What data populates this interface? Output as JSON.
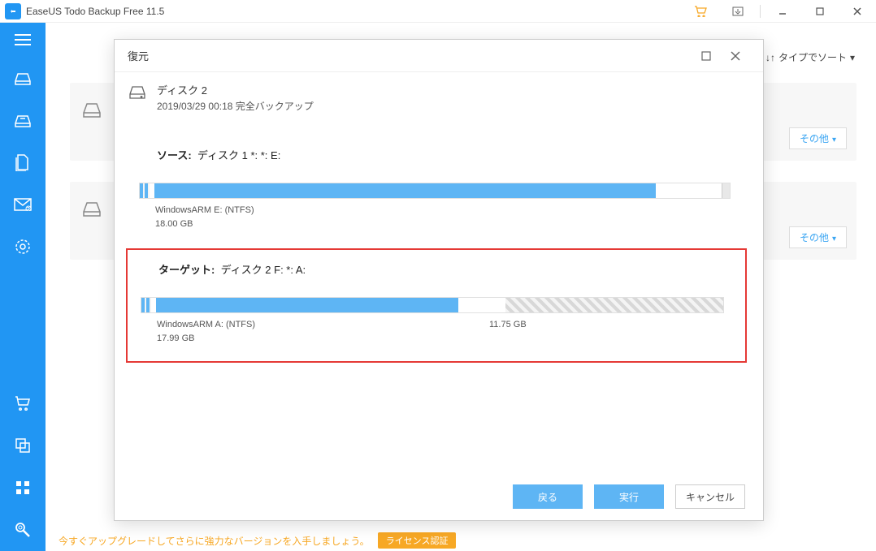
{
  "app": {
    "title": "EaseUS Todo Backup Free 11.5"
  },
  "topright": {
    "sort_label": "タイプでソート"
  },
  "cards": {
    "more_label": "その他"
  },
  "promo": {
    "text": "今すぐアップグレードしてさらに強力なバージョンを入手しましょう。",
    "button": "ライセンス認証"
  },
  "dialog": {
    "title": "復元",
    "disk": {
      "name": "ディスク 2",
      "detail": "2019/03/29 00:18 完全バックアップ"
    },
    "source": {
      "label": "ソース:",
      "value": "ディスク 1 *: *: E:",
      "partition_name": "WindowsARM E: (NTFS)",
      "partition_size": "18.00 GB"
    },
    "target": {
      "label": "ターゲット:",
      "value": "ディスク 2 F: *: A:",
      "partition_name": "WindowsARM A: (NTFS)",
      "partition_size": "17.99 GB",
      "unalloc_size": "11.75 GB"
    },
    "buttons": {
      "back": "戻る",
      "execute": "実行",
      "cancel": "キャンセル"
    }
  }
}
